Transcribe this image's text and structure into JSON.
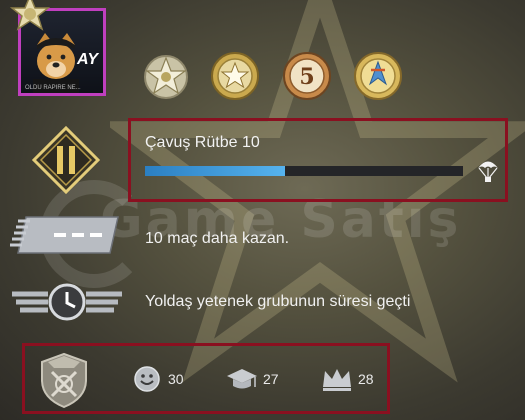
{
  "watermark": {
    "text": "Game Satış"
  },
  "profile": {
    "avatar_text": "AY",
    "avatar_caption": "OLDU RAPIRE NE..."
  },
  "medals": [
    {
      "icon": "service-medal-icon"
    },
    {
      "icon": "star-coin-icon"
    },
    {
      "icon": "five-year-coin-icon",
      "label": "5"
    },
    {
      "icon": "operation-coin-icon"
    }
  ],
  "rank": {
    "title": "Çavuş Rütbe 10",
    "progress": 0.44,
    "level_icon": "rank-II-icon",
    "reward_icon": "parachute-icon"
  },
  "missions": [
    {
      "icon": "wins-badge-icon",
      "text": "10 maç daha kazan."
    },
    {
      "icon": "cooldown-clock-icon",
      "text": "Yoldaş yetenek grubunun süresi geçti"
    }
  ],
  "stats": {
    "badge_icon": "skill-group-emblem-icon",
    "friendly": {
      "icon": "smile-icon",
      "value": "30"
    },
    "teacher": {
      "icon": "graduation-cap-icon",
      "value": "27"
    },
    "leader": {
      "icon": "crown-icon",
      "value": "28"
    }
  },
  "colors": {
    "progress": "#4aa3e0",
    "highlight_frame": "#8a1020",
    "avatar_border": "#c03fbf"
  }
}
